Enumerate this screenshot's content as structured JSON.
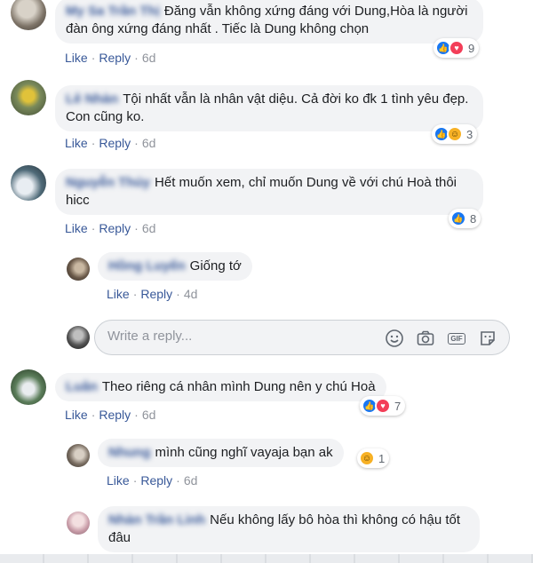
{
  "comments": [
    {
      "author": "My Sa Trần Thị",
      "text": "Đăng vẫn không xứng đáng với Dung,Hòa là người đàn ông xứng đáng nhất . Tiếc là Dung không chọn",
      "like_label": "Like",
      "reply_label": "Reply",
      "time": "6d",
      "reactions": [
        "like",
        "love"
      ],
      "reaction_count": "9"
    },
    {
      "author": "Lê Nhàn",
      "text": "Tội nhất vẫn là nhân vật diệu. Cả đời ko đk 1 tình yêu đẹp. Con cũng ko.",
      "like_label": "Like",
      "reply_label": "Reply",
      "time": "6d",
      "reactions": [
        "like",
        "haha"
      ],
      "reaction_count": "3"
    },
    {
      "author": "Nguyễn Thúy",
      "text": "Hết muốn xem, chỉ muốn Dung về với chú Hoà thôi hicc",
      "like_label": "Like",
      "reply_label": "Reply",
      "time": "6d",
      "reactions": [
        "like"
      ],
      "reaction_count": "8"
    },
    {
      "author": "Luân",
      "text": "Theo riêng cá nhân mình Dung nên y chú Hoà",
      "like_label": "Like",
      "reply_label": "Reply",
      "time": "6d",
      "reactions": [
        "like",
        "love"
      ],
      "reaction_count": "7"
    }
  ],
  "replies": [
    {
      "author": "Hồng Luyến",
      "text": "Giống tớ",
      "like_label": "Like",
      "reply_label": "Reply",
      "time": "4d"
    },
    {
      "author": "Nhung",
      "text": "mình cũng nghĩ vayaja bạn ak",
      "like_label": "Like",
      "reply_label": "Reply",
      "time": "6d",
      "reactions": [
        "haha"
      ],
      "reaction_count": "1"
    },
    {
      "author": "Nhàn Trần Linh",
      "text": "Nếu không lấy bô hòa thì không có hậu tốt đâu"
    }
  ],
  "reply_box": {
    "placeholder": "Write a reply...",
    "icons": [
      "emoji-icon",
      "camera-icon",
      "gif-icon",
      "sticker-icon"
    ]
  },
  "colors": {
    "link": "#385898",
    "bubble": "#f2f3f5",
    "like": "#1877f2",
    "love": "#f33e58",
    "haha": "#f7b125"
  }
}
